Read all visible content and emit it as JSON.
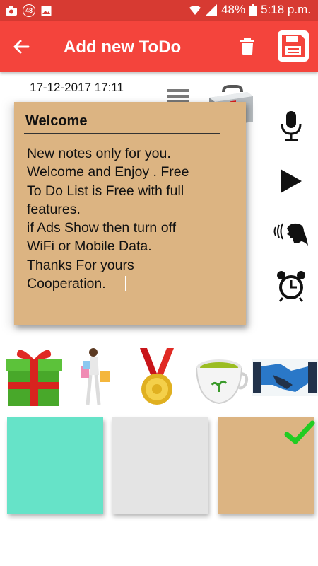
{
  "status_bar": {
    "notification_count": "48",
    "battery": "48%",
    "time": "5:18 p.m."
  },
  "appbar": {
    "title": "Add new ToDo",
    "back_icon": "arrow-left-icon",
    "delete_icon": "trash-icon",
    "save_icon": "floppy-disk-icon"
  },
  "note": {
    "date": "17-12-2017 17:11",
    "title": "Welcome",
    "body": "New notes only for you.\nWelcome and Enjoy . Free\nTo Do List is Free with full\nfeatures.\nif Ads Show then turn off\nWiFi or Mobile Data.\nThanks For yours\nCooperation."
  },
  "side_actions": [
    {
      "name": "microphone-icon"
    },
    {
      "name": "play-icon"
    },
    {
      "name": "speak-icon"
    },
    {
      "name": "alarm-clock-icon"
    }
  ],
  "stickers": [
    {
      "name": "gift-sticker"
    },
    {
      "name": "shopping-woman-sticker"
    },
    {
      "name": "medal-sticker"
    },
    {
      "name": "tea-cup-sticker"
    },
    {
      "name": "handshake-sticker"
    }
  ],
  "note_colors": [
    {
      "name": "mint",
      "color": "#66e3c8",
      "selected": false
    },
    {
      "name": "light-gray",
      "color": "#e4e4e4",
      "selected": false
    },
    {
      "name": "tan",
      "color": "#dcb482",
      "selected": true
    }
  ],
  "colors": {
    "status_bar": "#d73a32",
    "app_bar": "#f4443c",
    "check": "#22cc22"
  }
}
